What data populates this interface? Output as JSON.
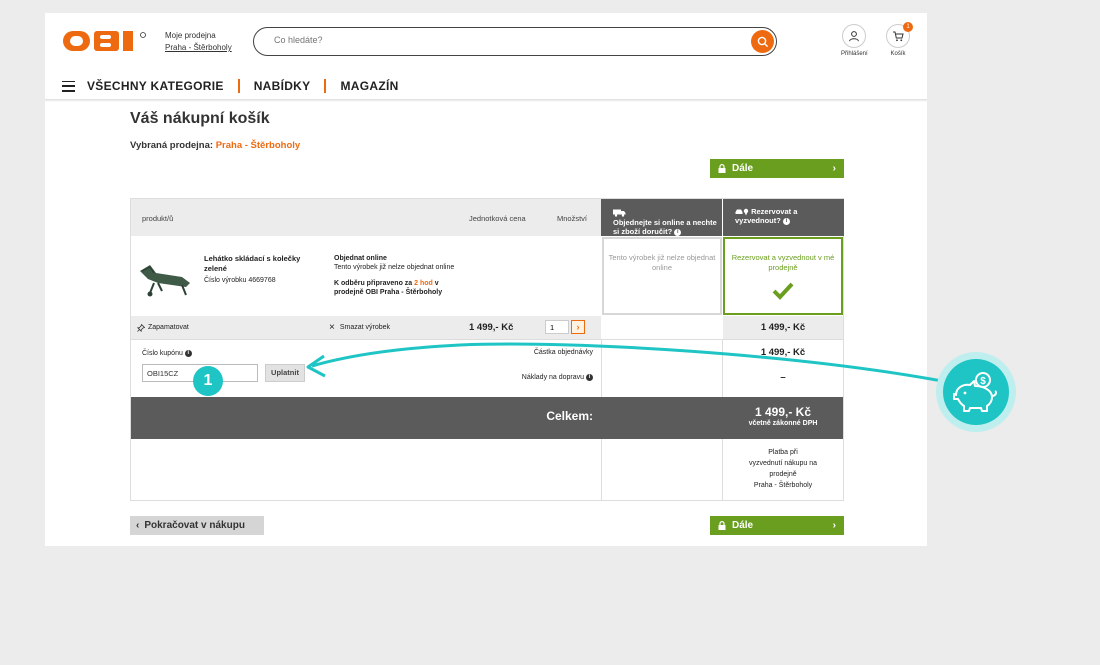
{
  "header": {
    "logo_text": "OBI",
    "store_label": "Moje prodejna",
    "store_link": "Praha - Štěrboholy",
    "search_placeholder": "Co hledáte?",
    "login_label": "Přihlášení",
    "cart_label": "Košík",
    "cart_count": "1",
    "brand_color": "#ee6a10"
  },
  "nav": {
    "items": [
      "VŠECHNY KATEGORIE",
      "NABÍDKY",
      "MAGAZÍN"
    ]
  },
  "cart": {
    "title": "Váš nákupní košík",
    "selected_store_label": "Vybraná prodejna:",
    "selected_store_value": "Praha - Štěrboholy",
    "next_label": "Dále",
    "continue_label": "Pokračovat v nákupu"
  },
  "table": {
    "col_product": "produkt/ů",
    "col_unit_price": "Jednotková cena",
    "col_qty": "Množství",
    "col_online": "Objednejte si online a nechte si zboží doručit?",
    "col_reserve": "Rezervovat a vyzvednout?",
    "product_name": "Lehátko skládací s kolečky zelené",
    "product_number": "Číslo výrobku 4669768",
    "online_title": "Objednat online",
    "online_text": "Tento výrobek již nelze objednat online",
    "pickup_prefix": "K odběru připraveno za",
    "pickup_time": "2 hod",
    "pickup_suffix": "v",
    "pickup_store": "prodejně OBI Praha - Štěrboholy",
    "online_option_text": "Tento výrobek již nelze objednat online",
    "reserve_option_text": "Rezervovat a vyzvednout v mé prodejně",
    "remember_label": "Zapamatovat",
    "delete_label": "Smazat výrobek",
    "unit_price": "1 499,- Kč",
    "quantity": "1",
    "row_total": "1 499,- Kč",
    "coupon_label": "Číslo kupónu",
    "coupon_value": "OBI15CZ",
    "apply_label": "Uplatnit",
    "order_amount_label": "Částka objednávky",
    "order_amount_value": "1 499,- Kč",
    "shipping_label": "Náklady na dopravu",
    "shipping_value": "–",
    "total_label": "Celkem:",
    "total_value": "1 499,- Kč",
    "vat_note": "včetně zákonné DPH",
    "payment_note_1": "Platba při",
    "payment_note_2": "vyzvednutí nákupu na",
    "payment_note_3": "prodejně",
    "payment_note_4": "Praha - Štěrboholy"
  },
  "annotation": {
    "step_number": "1",
    "accent_color": "#1fc4c4"
  }
}
